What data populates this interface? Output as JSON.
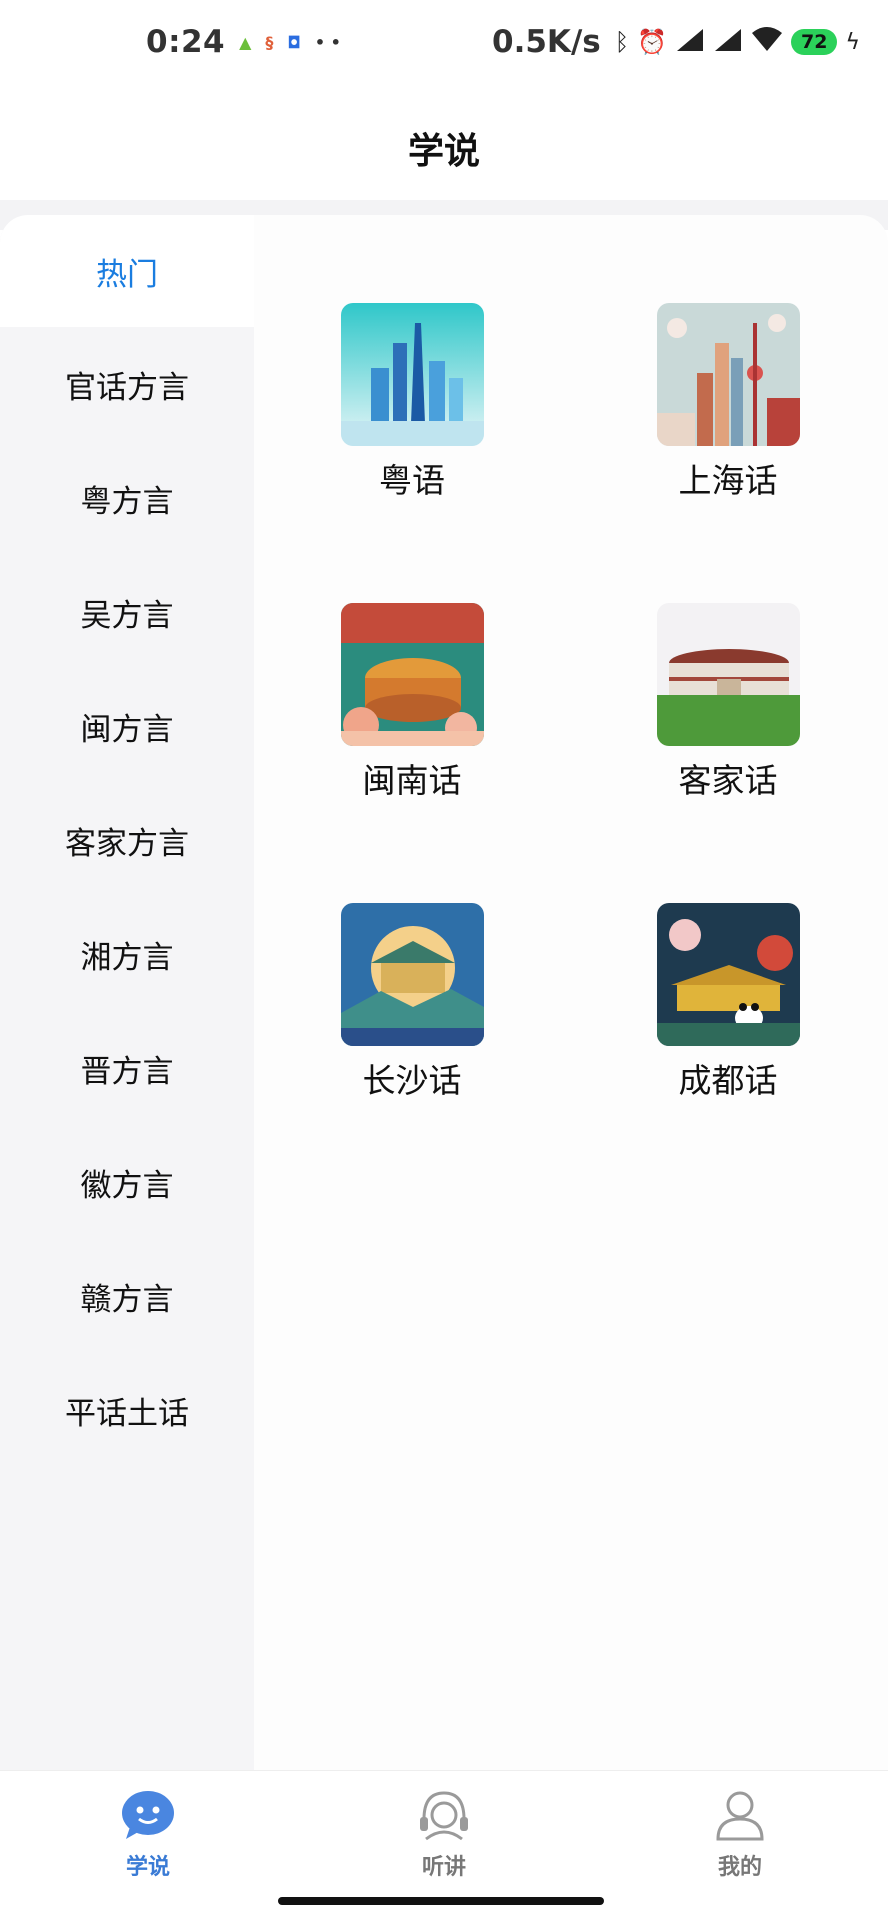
{
  "status_bar": {
    "time": "0:24",
    "app_icons": [
      "android-icon",
      "app-icon",
      "app-icon"
    ],
    "dots": "• •",
    "net_speed": "0.5K/s",
    "battery": "72"
  },
  "header": {
    "title": "学说"
  },
  "sidebar": {
    "items": [
      {
        "label": "热门",
        "active": true
      },
      {
        "label": "官话方言"
      },
      {
        "label": "粤方言"
      },
      {
        "label": "吴方言"
      },
      {
        "label": "闽方言"
      },
      {
        "label": "客家方言"
      },
      {
        "label": "湘方言"
      },
      {
        "label": "晋方言"
      },
      {
        "label": "徽方言"
      },
      {
        "label": "赣方言"
      },
      {
        "label": "平话土话"
      }
    ]
  },
  "dialects": [
    {
      "label": "粤语",
      "icon": "guangzhou-skyline-icon"
    },
    {
      "label": "上海话",
      "icon": "shanghai-skyline-icon"
    },
    {
      "label": "闽南话",
      "icon": "tulou-icon"
    },
    {
      "label": "客家话",
      "icon": "hakka-roundhouse-icon"
    },
    {
      "label": "长沙话",
      "icon": "changsha-pavilion-icon"
    },
    {
      "label": "成都话",
      "icon": "chengdu-panda-icon"
    }
  ],
  "tabbar": {
    "items": [
      {
        "label": "学说",
        "active": true,
        "icon": "chat-face-icon"
      },
      {
        "label": "听讲",
        "icon": "headphones-icon"
      },
      {
        "label": "我的",
        "icon": "person-icon"
      }
    ]
  },
  "colors": {
    "accent": "#1a7de0",
    "tab_active": "#3a7bd5",
    "tab_inactive": "#777777"
  }
}
